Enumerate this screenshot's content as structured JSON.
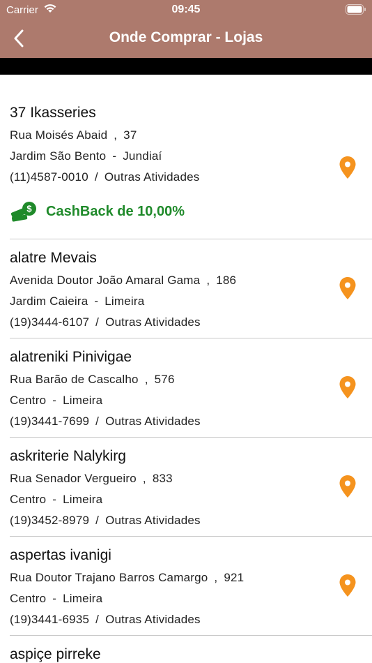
{
  "status_bar": {
    "carrier": "Carrier",
    "time": "09:45"
  },
  "nav": {
    "title": "Onde Comprar - Lojas"
  },
  "colors": {
    "header": "#ad7a6d",
    "pin": "#f5931e",
    "cashback": "#1f8a2a"
  },
  "stores": [
    {
      "name": "37 Ikasseries",
      "street": "Rua Moisés Abaid",
      "number": "37",
      "district": "Jardim São Bento",
      "city": "Jundiaí",
      "phone": "(11)4587-0010",
      "category": "Outras Atividades",
      "cashback": "CashBack de 10,00%"
    },
    {
      "name": "alatre Mevais",
      "street": "Avenida Doutor João Amaral Gama",
      "number": "186",
      "district": "Jardim Caieira",
      "city": "Limeira",
      "phone": "(19)3444-6107",
      "category": "Outras Atividades"
    },
    {
      "name": "alatreniki Pinivigae",
      "street": "Rua Barão de Cascalho",
      "number": "576",
      "district": "Centro",
      "city": "Limeira",
      "phone": "(19)3441-7699",
      "category": "Outras Atividades"
    },
    {
      "name": "askriterie Nalykirg",
      "street": "Rua Senador Vergueiro",
      "number": "833",
      "district": "Centro",
      "city": "Limeira",
      "phone": "(19)3452-8979",
      "category": "Outras Atividades"
    },
    {
      "name": "aspertas ivanigi",
      "street": "Rua Doutor Trajano Barros Camargo",
      "number": "921",
      "district": "Centro",
      "city": "Limeira",
      "phone": "(19)3441-6935",
      "category": "Outras Atividades"
    },
    {
      "name": "aspiçe pirreke"
    }
  ]
}
